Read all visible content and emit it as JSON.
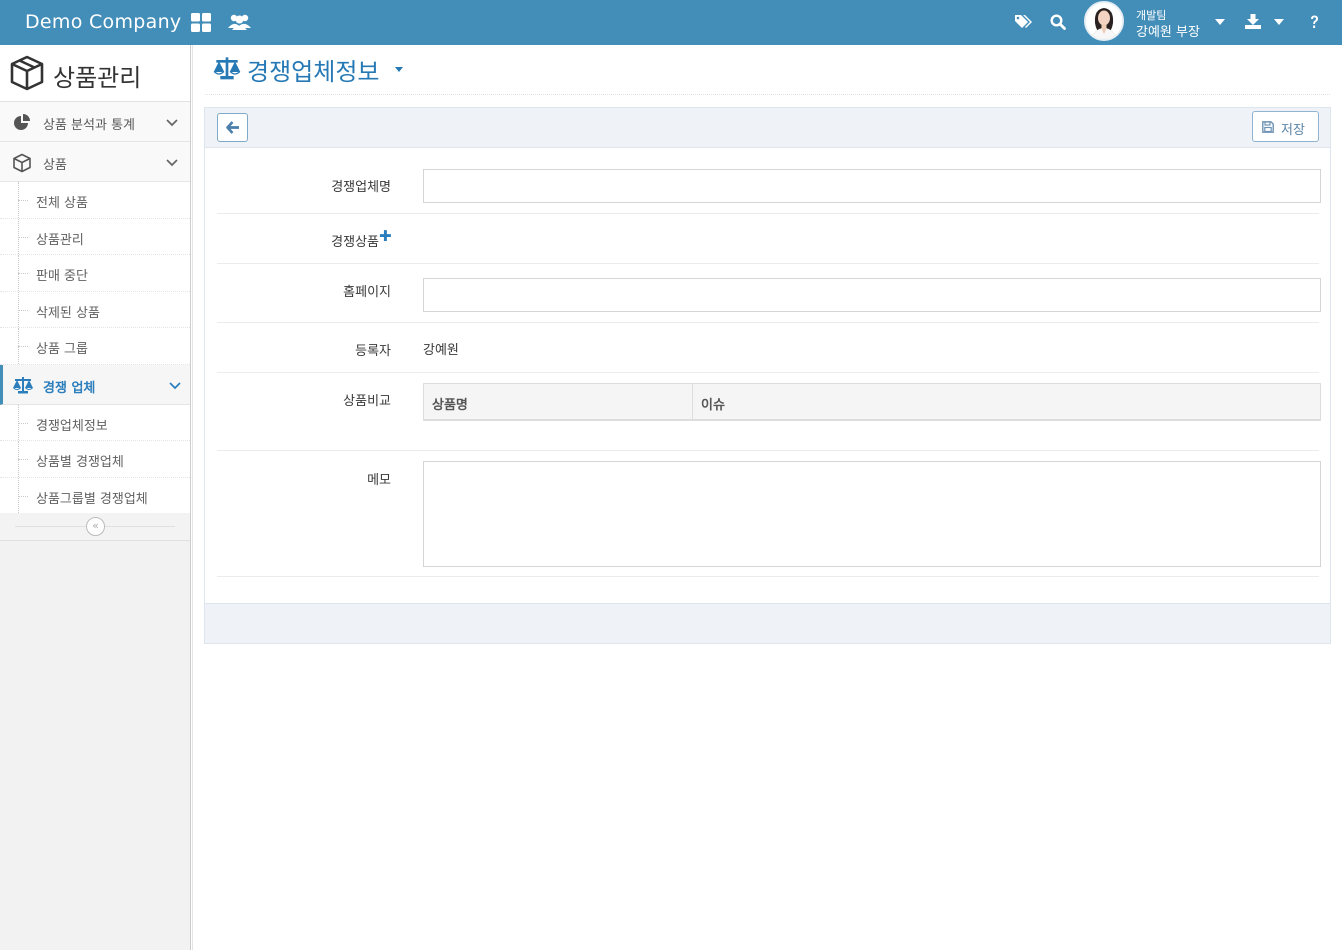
{
  "navbar": {
    "brand": "Demo Company",
    "user": {
      "team": "개발팀",
      "name": "강예원 부장"
    }
  },
  "sidebar": {
    "title": "상품관리",
    "menu": [
      {
        "label": "상품 분석과 통계"
      },
      {
        "label": "상품"
      },
      {
        "label": "전체 상품"
      },
      {
        "label": "상품관리"
      },
      {
        "label": "판매 중단"
      },
      {
        "label": "삭제된 상품"
      },
      {
        "label": "상품 그룹"
      },
      {
        "label": "경쟁 업체"
      },
      {
        "label": "경쟁업체정보"
      },
      {
        "label": "상품별 경쟁업체"
      },
      {
        "label": "상품그룹별 경쟁업체"
      }
    ]
  },
  "page": {
    "title": "경쟁업체정보"
  },
  "toolbar": {
    "save_label": "저장"
  },
  "form": {
    "competitor_name_label": "경쟁업체명",
    "competitor_name_value": "",
    "competitor_products_label": "경쟁상품",
    "homepage_label": "홈페이지",
    "homepage_value": "",
    "registrant_label": "등록자",
    "registrant_value": "강예원",
    "comparison_label": "상품비교",
    "comparison_columns": [
      "상품명",
      "이슈"
    ],
    "memo_label": "메모",
    "memo_value": ""
  },
  "colors": {
    "navbar": "#438eb9",
    "accent": "#2679b5",
    "toolbar": "#eff3f8"
  }
}
